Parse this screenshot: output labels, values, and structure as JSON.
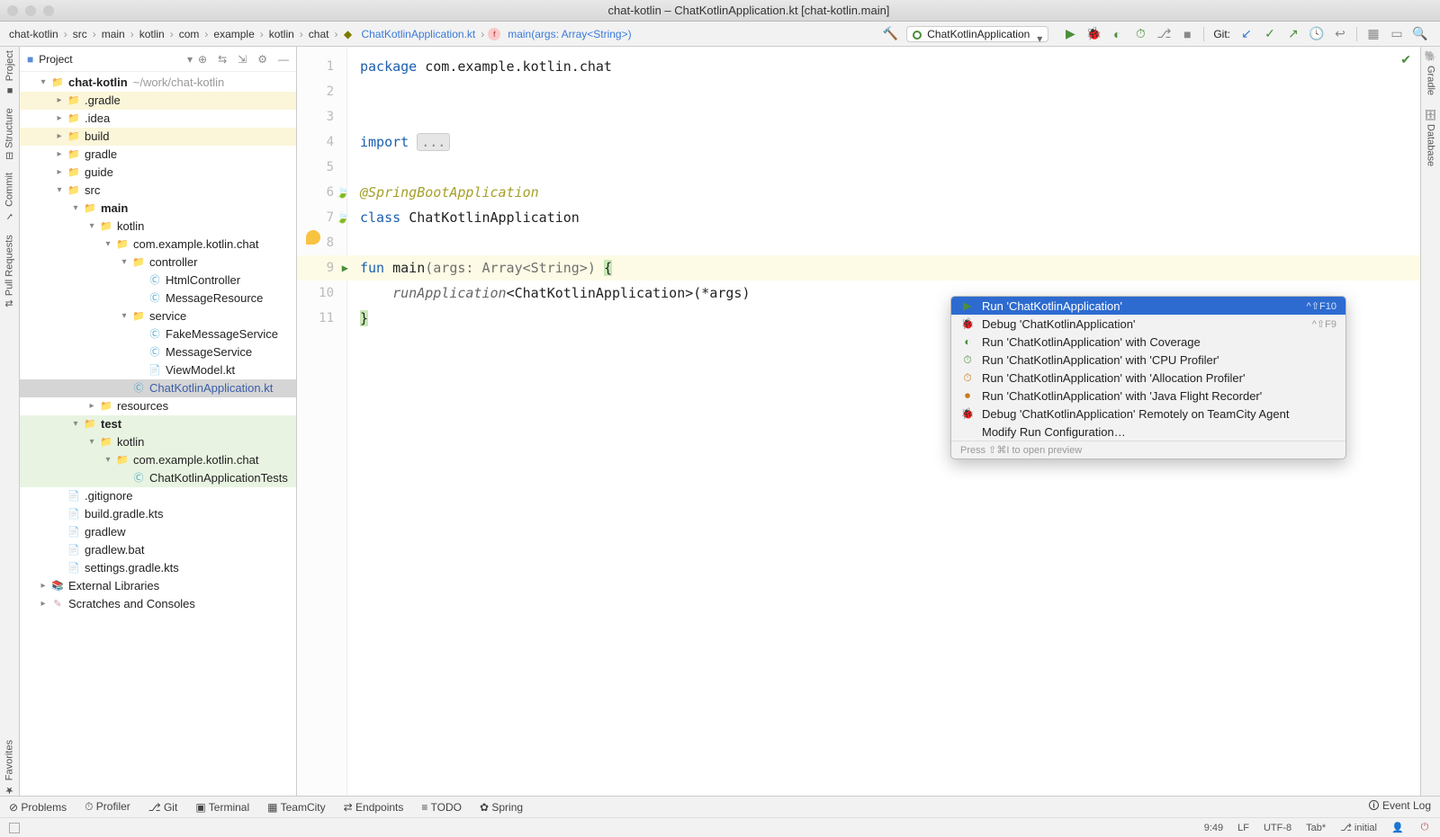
{
  "window": {
    "title": "chat-kotlin – ChatKotlinApplication.kt [chat-kotlin.main]"
  },
  "breadcrumb": [
    "chat-kotlin",
    "src",
    "main",
    "kotlin",
    "com",
    "example",
    "kotlin",
    "chat",
    "ChatKotlinApplication.kt",
    "main(args: Array<String>)"
  ],
  "runConfig": "ChatKotlinApplication",
  "gitLabel": "Git:",
  "leftTabs": [
    "Project",
    "Structure",
    "Commit",
    "Pull Requests",
    "Favorites"
  ],
  "rightTabs": [
    "Gradle",
    "Database"
  ],
  "projectPanel": {
    "title": "Project"
  },
  "tree": [
    {
      "d": 0,
      "a": "v",
      "i": "folder-gray",
      "t": "chat-kotlin",
      "b": true,
      "path": "~/work/chat-kotlin"
    },
    {
      "d": 1,
      "a": ">",
      "i": "folder-orange",
      "t": ".gradle",
      "hl": "y"
    },
    {
      "d": 1,
      "a": ">",
      "i": "folder-gray",
      "t": ".idea"
    },
    {
      "d": 1,
      "a": ">",
      "i": "folder-orange",
      "t": "build",
      "hl": "y"
    },
    {
      "d": 1,
      "a": ">",
      "i": "folder-gray",
      "t": "gradle"
    },
    {
      "d": 1,
      "a": ">",
      "i": "folder-gray",
      "t": "guide"
    },
    {
      "d": 1,
      "a": "v",
      "i": "folder-blue",
      "t": "src"
    },
    {
      "d": 2,
      "a": "v",
      "i": "folder-blue",
      "t": "main",
      "b": true
    },
    {
      "d": 3,
      "a": "v",
      "i": "folder-blue",
      "t": "kotlin"
    },
    {
      "d": 4,
      "a": "v",
      "i": "folder-gray",
      "t": "com.example.kotlin.chat"
    },
    {
      "d": 5,
      "a": "v",
      "i": "folder-gray",
      "t": "controller"
    },
    {
      "d": 6,
      "a": "",
      "i": "kt-class",
      "t": "HtmlController"
    },
    {
      "d": 6,
      "a": "",
      "i": "kt-class",
      "t": "MessageResource"
    },
    {
      "d": 5,
      "a": "v",
      "i": "folder-gray",
      "t": "service"
    },
    {
      "d": 6,
      "a": "",
      "i": "kt-class",
      "t": "FakeMessageService"
    },
    {
      "d": 6,
      "a": "",
      "i": "kt-class",
      "t": "MessageService"
    },
    {
      "d": 6,
      "a": "",
      "i": "kt-file",
      "t": "ViewModel.kt"
    },
    {
      "d": 5,
      "a": "",
      "i": "kt-class",
      "t": "ChatKotlinApplication.kt",
      "sel": true,
      "blue": true
    },
    {
      "d": 3,
      "a": ">",
      "i": "folder-gray",
      "t": "resources"
    },
    {
      "d": 2,
      "a": "v",
      "i": "folder-green",
      "t": "test",
      "b": true,
      "hl": "g"
    },
    {
      "d": 3,
      "a": "v",
      "i": "folder-green",
      "t": "kotlin",
      "hl": "g"
    },
    {
      "d": 4,
      "a": "v",
      "i": "folder-gray",
      "t": "com.example.kotlin.chat",
      "hl": "g"
    },
    {
      "d": 5,
      "a": "",
      "i": "kt-class",
      "t": "ChatKotlinApplicationTests",
      "hl": "g"
    },
    {
      "d": 1,
      "a": "",
      "i": "file-gray",
      "t": ".gitignore"
    },
    {
      "d": 1,
      "a": "",
      "i": "kt-file",
      "t": "build.gradle.kts"
    },
    {
      "d": 1,
      "a": "",
      "i": "file-gray",
      "t": "gradlew"
    },
    {
      "d": 1,
      "a": "",
      "i": "file-gray",
      "t": "gradlew.bat"
    },
    {
      "d": 1,
      "a": "",
      "i": "kt-file",
      "t": "settings.gradle.kts"
    },
    {
      "d": 0,
      "a": ">",
      "i": "lib",
      "t": "External Libraries"
    },
    {
      "d": 0,
      "a": ">",
      "i": "scratch",
      "t": "Scratches and Consoles"
    }
  ],
  "gutterLines": [
    "1",
    "2",
    "3",
    "4",
    "5",
    "6",
    "7",
    "8",
    "9",
    "10",
    "11"
  ],
  "code": {
    "l1a": "package ",
    "l1b": "com.example.kotlin.chat",
    "l4a": "import ",
    "l4b": "...",
    "l6": "@SpringBootApplication",
    "l7a": "class ",
    "l7b": "ChatKotlinApplication",
    "l9a": "fun ",
    "l9b": "main",
    "l9c": "(args: Array<String>) ",
    "l9d": "{",
    "l10a": "    ",
    "l10b": "runApplication",
    "l10c": "<ChatKotlinApplication>(*args)",
    "l11": "}"
  },
  "contextMenu": {
    "items": [
      {
        "icon": "▶",
        "c": "green",
        "label": "Run 'ChatKotlinApplication'",
        "sc": "^⇧F10",
        "sel": true
      },
      {
        "icon": "🐞",
        "c": "green",
        "label": "Debug 'ChatKotlinApplication'",
        "sc": "^⇧F9"
      },
      {
        "icon": "◐",
        "c": "green",
        "label": "Run 'ChatKotlinApplication' with Coverage"
      },
      {
        "icon": "⏱",
        "c": "green",
        "label": "Run 'ChatKotlinApplication' with 'CPU Profiler'"
      },
      {
        "icon": "⏱",
        "c": "orange",
        "label": "Run 'ChatKotlinApplication' with 'Allocation Profiler'"
      },
      {
        "icon": "⏺",
        "c": "orange",
        "label": "Run 'ChatKotlinApplication' with 'Java Flight Recorder'"
      },
      {
        "icon": "🐞",
        "c": "green",
        "label": "Debug 'ChatKotlinApplication' Remotely on TeamCity Agent"
      },
      {
        "icon": "",
        "c": "",
        "label": "Modify Run Configuration…"
      }
    ],
    "footer": "Press ⇧⌘I to open preview"
  },
  "bottomBar": [
    "Problems",
    "Profiler",
    "Git",
    "Terminal",
    "TeamCity",
    "Endpoints",
    "TODO",
    "Spring",
    "Event Log"
  ],
  "status": {
    "pos": "9:49",
    "le": "LF",
    "enc": "UTF-8",
    "tab": "Tab*",
    "branch": "initial"
  }
}
